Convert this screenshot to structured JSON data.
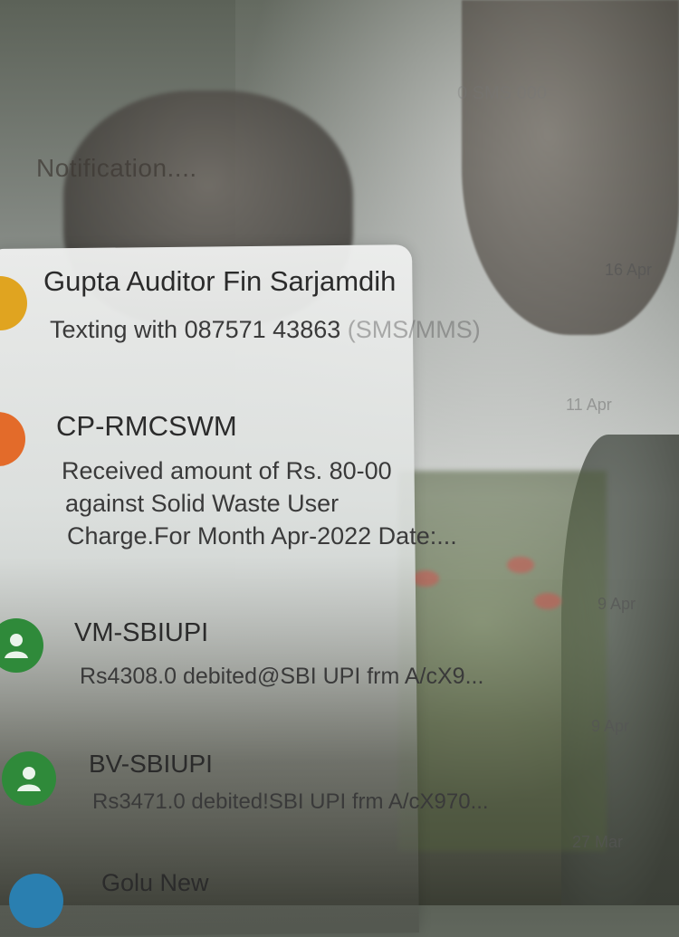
{
  "header": {
    "title": "Notification....",
    "top_right_faint": "0 SMS 000"
  },
  "conversations": [
    {
      "name": "Gupta Auditor Fin Sarjamdih",
      "snippet_main": "Texting with 087571 43863",
      "snippet_tail": " (SMS/MMS)",
      "date": "16 Apr",
      "avatar_color": "#e0a420",
      "avatar_icon": "contact-initial-icon"
    },
    {
      "name": "CP-RMCSWM",
      "snippet_lines": [
        "Received amount of Rs. 80-00",
        "against Solid Waste User",
        "Charge.For Month Apr-2022 Date:..."
      ],
      "date": "11 Apr",
      "avatar_color": "#e36b2a",
      "avatar_icon": "contact-initial-icon"
    },
    {
      "name": "VM-SBIUPI",
      "snippet_main": "Rs4308.0 debited@SBI UPI frm A/cX9...",
      "date": "9 Apr",
      "avatar_color": "#2f8a3a",
      "avatar_icon": "person-icon"
    },
    {
      "name": "BV-SBIUPI",
      "snippet_main": "Rs3471.0 debited!SBI UPI frm A/cX970...",
      "date": "9 Apr",
      "avatar_color": "#2f8a3a",
      "avatar_icon": "person-icon"
    },
    {
      "name": "Golu New",
      "date": "27 Mar",
      "avatar_color": "#2a7fb0",
      "avatar_icon": "contact-initial-icon"
    }
  ]
}
